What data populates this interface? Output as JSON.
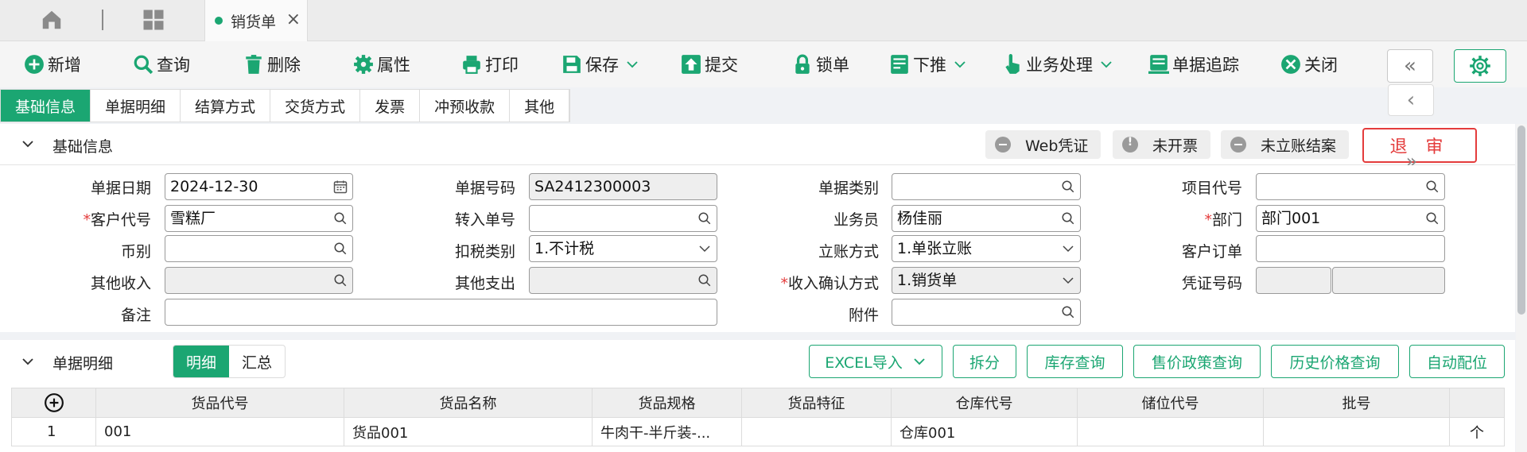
{
  "tabs": {
    "active_label": "销货单",
    "close": "×"
  },
  "toolbar": {
    "new": "新增",
    "query": "查询",
    "delete": "删除",
    "properties": "属性",
    "print": "打印",
    "save": "保存",
    "submit": "提交",
    "lock": "锁单",
    "push_down": "下推",
    "business": "业务处理",
    "trace": "单据追踪",
    "close": "关闭",
    "prev_all": "«",
    "prev": "‹",
    "next_all": "»"
  },
  "section_tabs": [
    "基础信息",
    "单据明细",
    "结算方式",
    "交货方式",
    "发票",
    "冲预收款",
    "其他"
  ],
  "basic": {
    "title": "基础信息",
    "status": {
      "voucher": "Web凭证",
      "invoice": "未开票",
      "account": "未立账结案"
    },
    "unaudit": "退 审",
    "labels": {
      "date": "单据日期",
      "doc_no": "单据号码",
      "doc_type": "单据类别",
      "project": "项目代号",
      "customer": "客户代号",
      "transfer": "转入单号",
      "salesman": "业务员",
      "dept": "部门",
      "currency": "币别",
      "tax": "扣税类别",
      "account_mode": "立账方式",
      "cust_order": "客户订单",
      "other_income": "其他收入",
      "other_expense": "其他支出",
      "income_confirm": "收入确认方式",
      "voucher_no": "凭证号码",
      "remark": "备注",
      "attachment": "附件",
      "required_mark": "*"
    },
    "values": {
      "date": "2024-12-30",
      "doc_no": "SA2412300003",
      "customer": "雪糕厂",
      "salesman": "杨佳丽",
      "dept": "部门001",
      "tax": "1.不计税",
      "account_mode": "1.单张立账",
      "income_confirm": "1.销货单"
    }
  },
  "detail": {
    "title": "单据明细",
    "seg": [
      "明细",
      "汇总"
    ],
    "buttons": [
      "EXCEL导入",
      "拆分",
      "库存查询",
      "售价政策查询",
      "历史价格查询",
      "自动配位"
    ],
    "columns": [
      "货品代号",
      "货品名称",
      "货品规格",
      "货品特征",
      "仓库代号",
      "储位代号",
      "批号"
    ],
    "rows": [
      {
        "no": "1",
        "code": "001",
        "name": "货品001",
        "spec": "牛肉干-半斤装-...",
        "feature": "",
        "warehouse": "仓库001",
        "location": "",
        "batch": "",
        "unit": "个"
      }
    ]
  },
  "colors": {
    "accent": "#1ba672",
    "danger": "#e43c3c"
  }
}
